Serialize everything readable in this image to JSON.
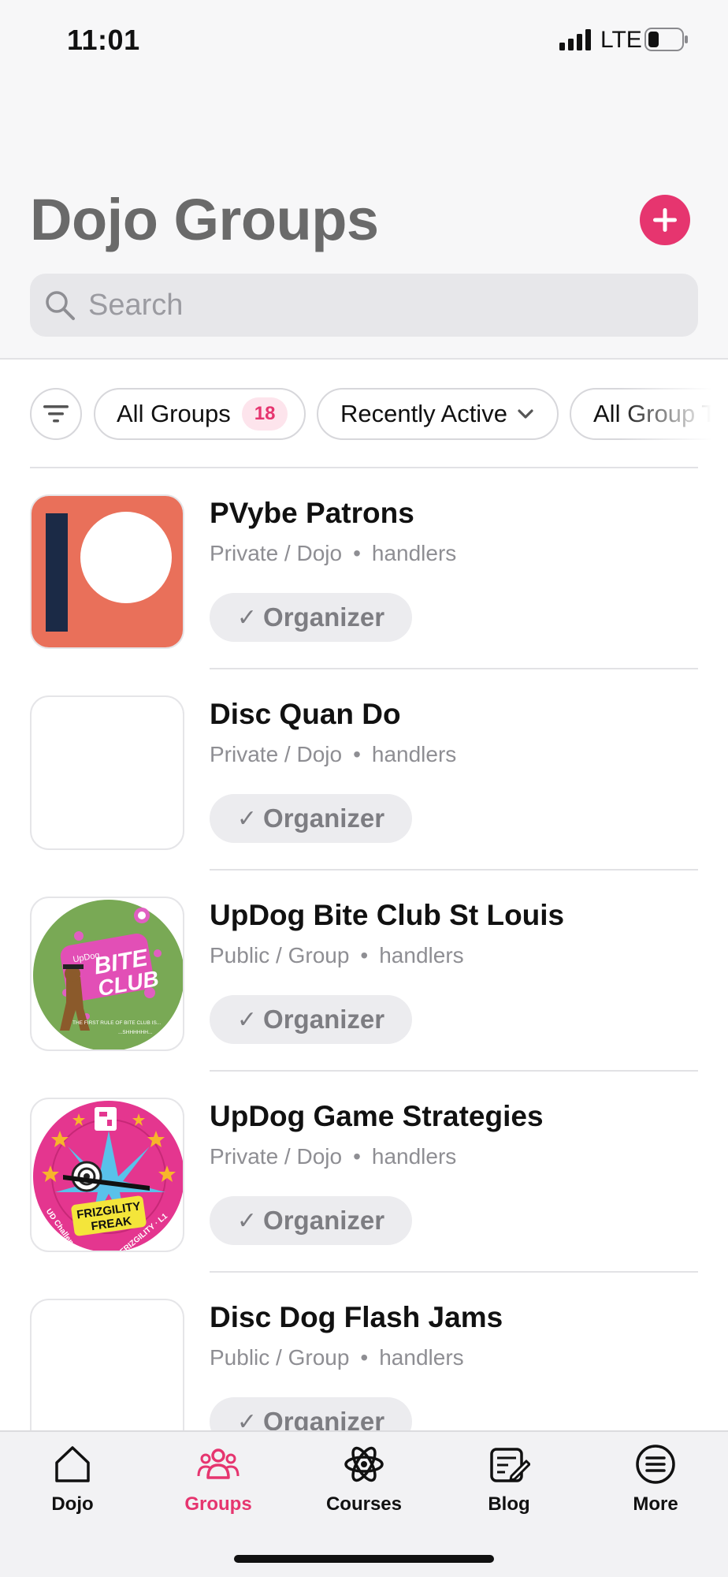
{
  "status_bar": {
    "time": "11:01",
    "network": "LTE"
  },
  "header": {
    "title": "Dojo Groups",
    "add_icon": "plus-icon",
    "search": {
      "placeholder": "Search",
      "value": "",
      "icon": "search-icon"
    }
  },
  "filters": {
    "filter_icon": "filter-lines-icon",
    "all_groups": {
      "label": "All Groups",
      "count": "18"
    },
    "sort": {
      "label": "Recently Active",
      "icon": "chevron-down-icon"
    },
    "type": {
      "label": "All Group Types"
    }
  },
  "groups": [
    {
      "name": "PVybe Patrons",
      "privacy": "Private / Dojo",
      "members": "handlers",
      "role": "Organizer",
      "avatar": "patreon-logo"
    },
    {
      "name": "Disc Quan Do",
      "privacy": "Private / Dojo",
      "members": "handlers",
      "role": "Organizer",
      "avatar": "blank"
    },
    {
      "name": "UpDog Bite Club St Louis",
      "privacy": "Public / Group",
      "members": "handlers",
      "role": "Organizer",
      "avatar": "bite-club-badge",
      "avatar_text": {
        "brand": "UpDog",
        "title1": "BITE",
        "title2": "CLUB",
        "footer": "THE FIRST RULE OF BITE CLUB IS...",
        "footer2": "...SHHHHHH..."
      }
    },
    {
      "name": "UpDog Game Strategies",
      "privacy": "Private / Dojo",
      "members": "handlers",
      "role": "Organizer",
      "avatar": "frizgility-badge",
      "avatar_text": {
        "title1": "FRIZGILITY",
        "title2": "FREAK",
        "ring_left": "UD Challenge",
        "ring_right": "FRIZGILITY · L1"
      }
    },
    {
      "name": "Disc Dog Flash Jams",
      "privacy": "Public / Group",
      "members": "handlers",
      "role": "Organizer",
      "avatar": "blank"
    }
  ],
  "tabbar": [
    {
      "label": "Dojo",
      "icon": "home-icon",
      "active": false
    },
    {
      "label": "Groups",
      "icon": "people-icon",
      "active": true
    },
    {
      "label": "Courses",
      "icon": "atom-icon",
      "active": false
    },
    {
      "label": "Blog",
      "icon": "note-edit-icon",
      "active": false
    },
    {
      "label": "More",
      "icon": "list-circle-icon",
      "active": false
    }
  ],
  "colors": {
    "accent": "#e6356f",
    "title_gray": "#6a6a6a",
    "meta_gray": "#8e8e93"
  }
}
